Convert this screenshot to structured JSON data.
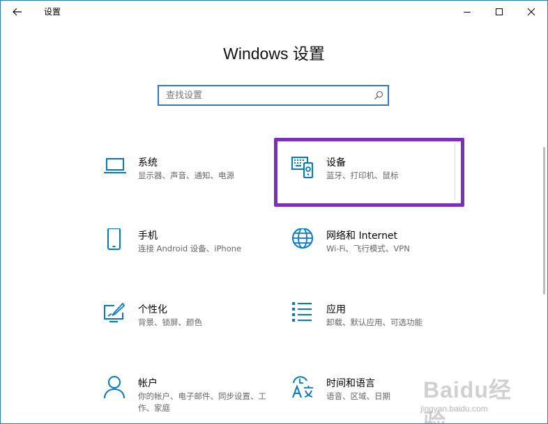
{
  "window": {
    "title": "设置"
  },
  "heading": "Windows 设置",
  "search": {
    "placeholder": "查找设置"
  },
  "colors": {
    "accent": "#0078d7",
    "highlight": "#7b2fbf",
    "border": "#2b79c9"
  },
  "tiles": [
    {
      "name": "系统",
      "desc": "显示器、声音、通知、电源",
      "icon": "laptop-icon"
    },
    {
      "name": "设备",
      "desc": "蓝牙、打印机、鼠标",
      "icon": "keyboard-icon"
    },
    {
      "name": "手机",
      "desc": "连接 Android 设备、iPhone",
      "icon": "phone-icon"
    },
    {
      "name": "网络和 Internet",
      "desc": "Wi-Fi、飞行模式、VPN",
      "icon": "globe-icon"
    },
    {
      "name": "个性化",
      "desc": "背景、锁屏、颜色",
      "icon": "paint-icon"
    },
    {
      "name": "应用",
      "desc": "卸载、默认应用、可选功能",
      "icon": "apps-list-icon"
    },
    {
      "name": "帐户",
      "desc": "你的帐户、电子邮件、同步设置、工作、家庭",
      "icon": "person-icon"
    },
    {
      "name": "时间和语言",
      "desc": "语音、区域、日期",
      "icon": "time-language-icon"
    }
  ],
  "watermark": {
    "brand": "Baidu经验",
    "url": "jingyan.baidu.com"
  }
}
